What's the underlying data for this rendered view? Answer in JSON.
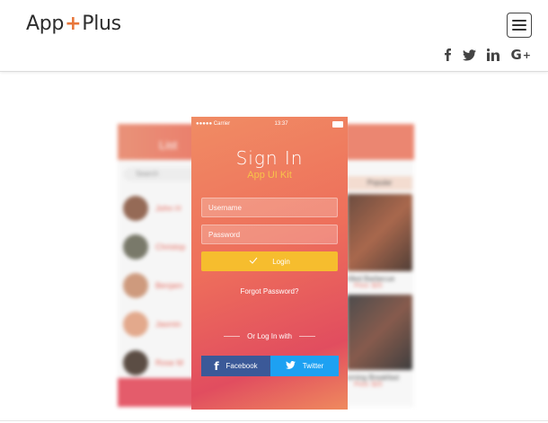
{
  "header": {
    "logo_app": "App",
    "logo_plus": "+",
    "logo_suffix": "Plus",
    "menu_label": "Menu"
  },
  "social": [
    {
      "name": "facebook-icon",
      "glyph": "f"
    },
    {
      "name": "twitter-icon",
      "glyph": "🐦"
    },
    {
      "name": "linkedin-icon",
      "glyph": "in"
    },
    {
      "name": "google-plus-icon",
      "glyph": "G+"
    }
  ],
  "main_phone": {
    "status": {
      "carrier": "●●●●● Carrier",
      "time": "13:37"
    },
    "title": "Sign In",
    "subtitle": "App UI Kit",
    "username_placeholder": "Username",
    "password_placeholder": "Password",
    "login_label": "Login",
    "forgot_label": "Forgot Password?",
    "or_label": "Or Log In with",
    "facebook_label": "Facebook",
    "twitter_label": "Twitter"
  },
  "left_phone": {
    "title": "List",
    "search_placeholder": "Search",
    "names": [
      "John H",
      "Christop",
      "Benjam",
      "Jasmin",
      "Rose M"
    ]
  },
  "right_phone": {
    "tab": "Popular",
    "caption1": "rilled Barbecue",
    "price1": "Price: $25",
    "caption2": "orning Breakfast",
    "price2": "Price: $25"
  },
  "colors": {
    "accent": "#e8763a",
    "login_button": "#f6bd2e",
    "facebook": "#3b5998",
    "twitter": "#1da1f2"
  }
}
